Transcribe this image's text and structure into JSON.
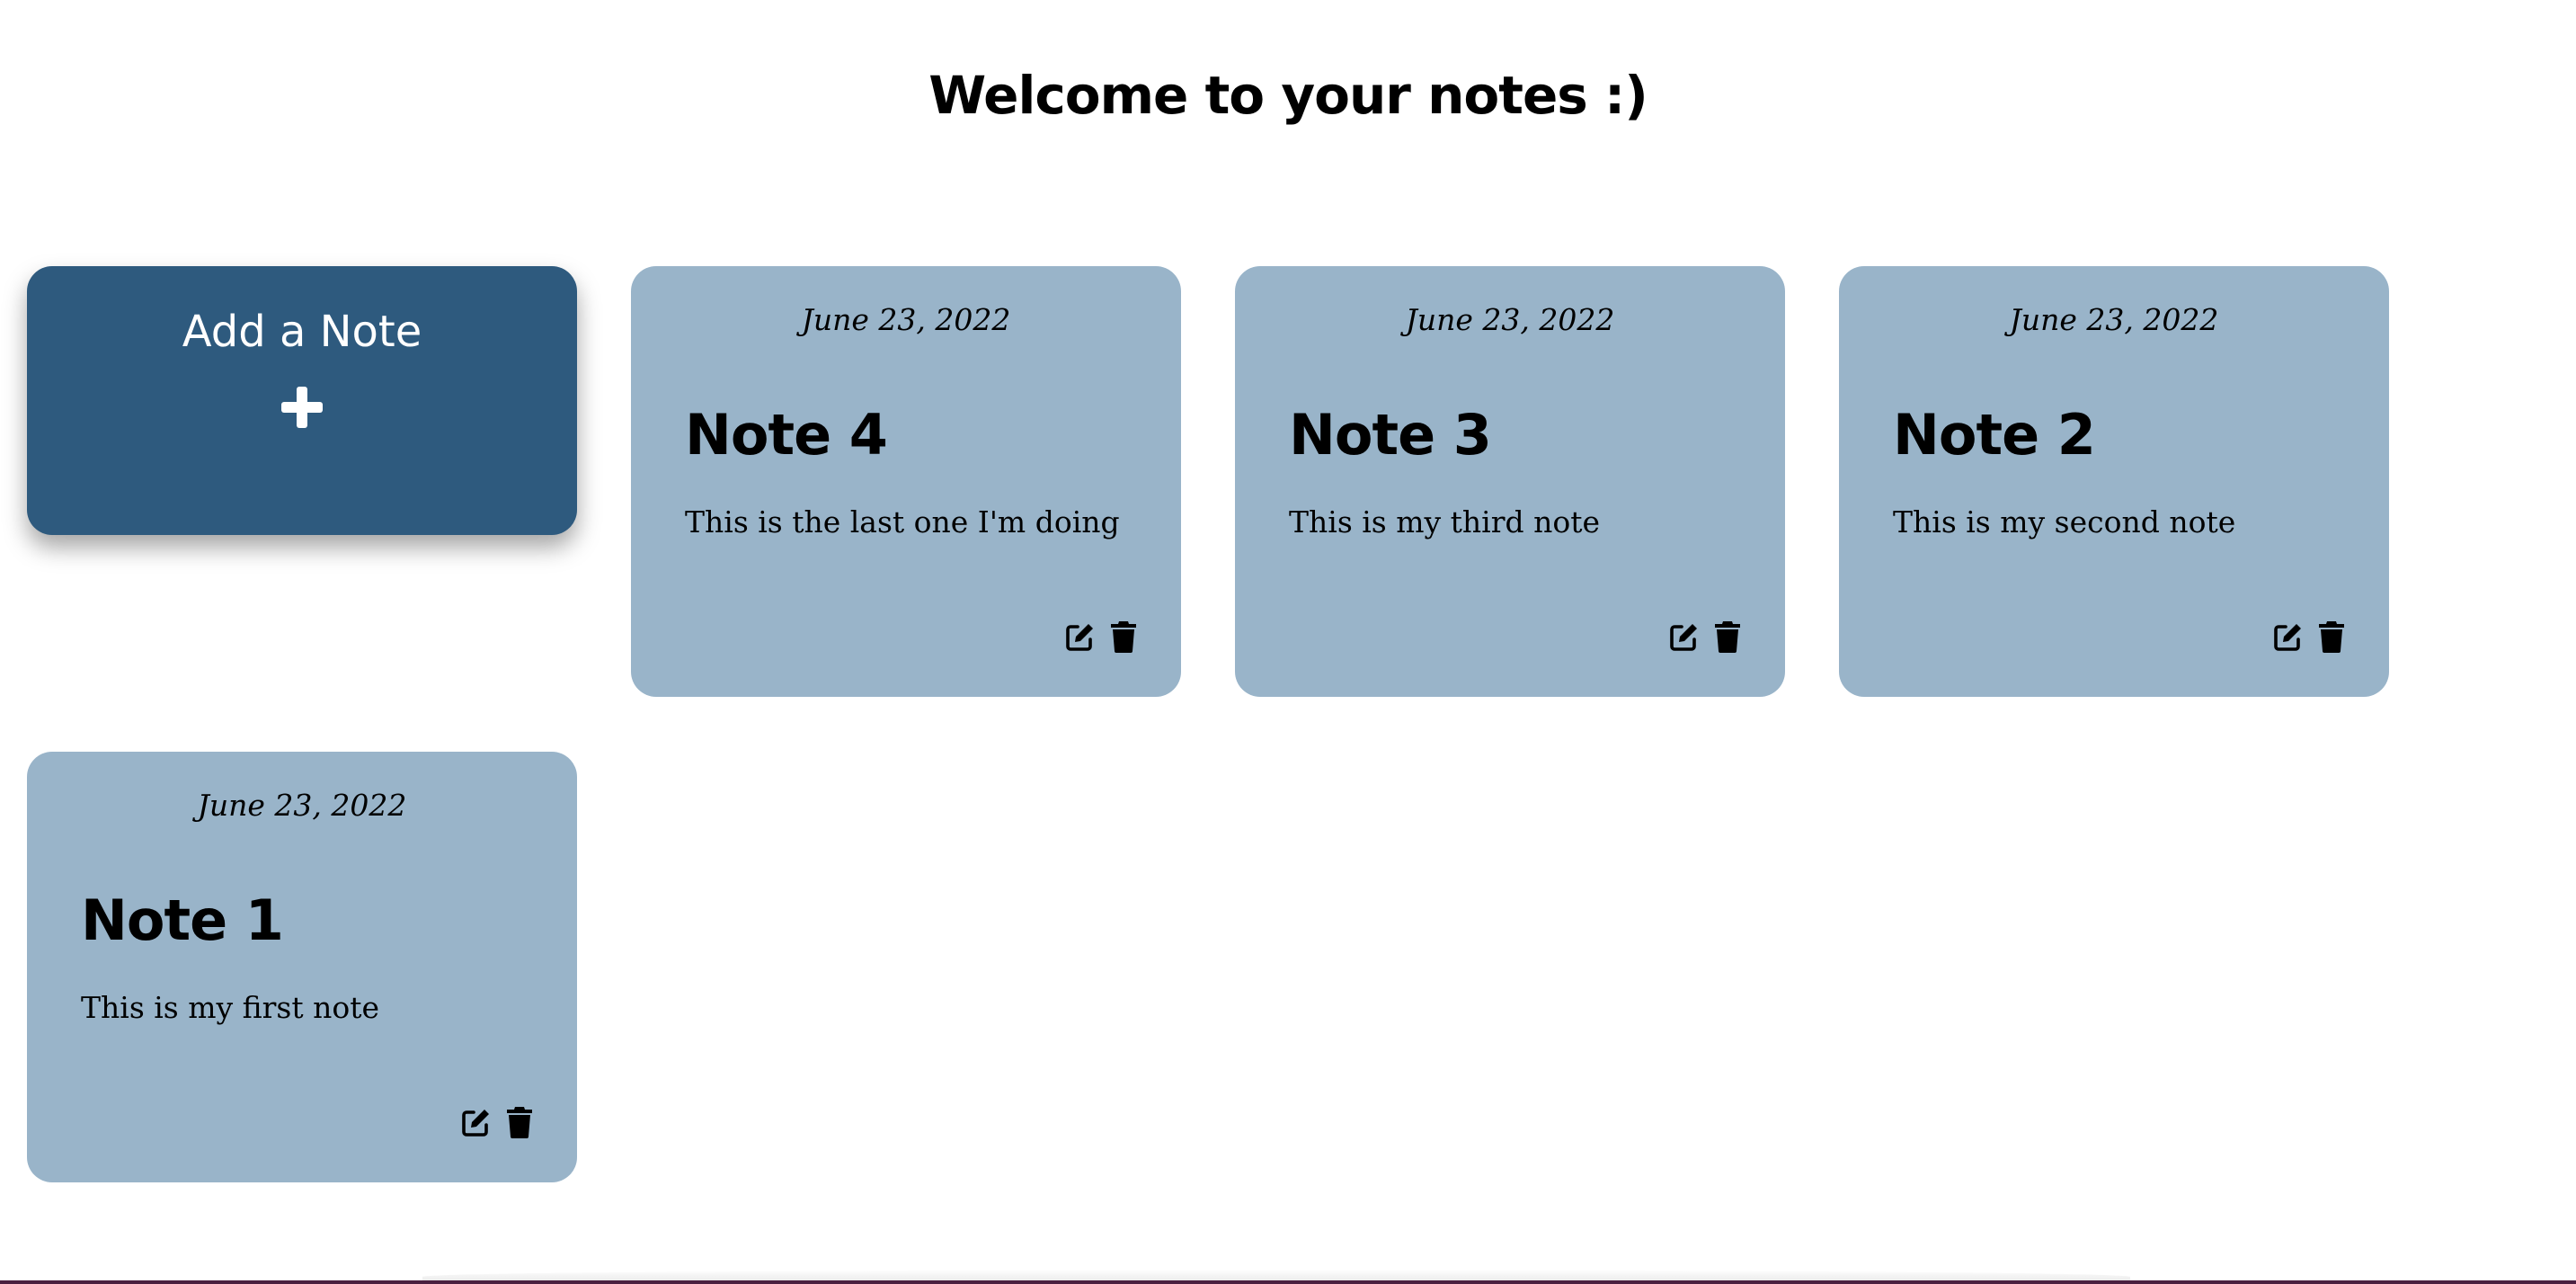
{
  "header": {
    "title": "Welcome to your notes :)"
  },
  "add_note": {
    "label": "Add a Note",
    "icon": "plus-icon"
  },
  "notes": [
    {
      "date": "June 23, 2022",
      "title": "Note 4",
      "text": "This is the last one I'm doing"
    },
    {
      "date": "June 23, 2022",
      "title": "Note 3",
      "text": "This is my third note"
    },
    {
      "date": "June 23, 2022",
      "title": "Note 2",
      "text": "This is my second note"
    },
    {
      "date": "June 23, 2022",
      "title": "Note 1",
      "text": "This is my first note"
    }
  ],
  "actions": {
    "edit_icon": "edit-icon",
    "delete_icon": "trash-icon"
  },
  "colors": {
    "add_card": "#2e5a7e",
    "note_card": "#99b4c9",
    "text": "#000000",
    "background": "#ffffff"
  }
}
